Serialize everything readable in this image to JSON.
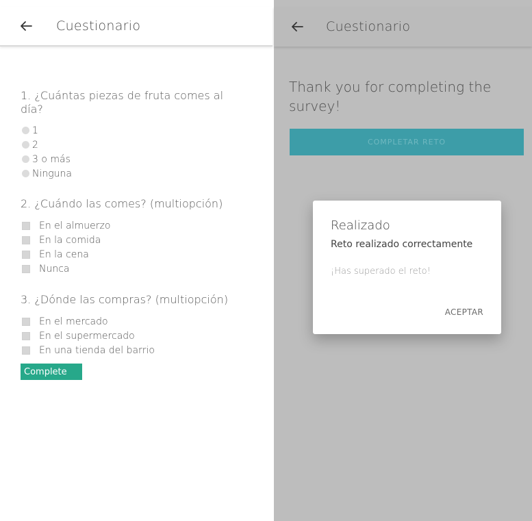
{
  "left_screen": {
    "appbar": {
      "title": "Cuestionario"
    },
    "questions": [
      {
        "text": "1. ¿Cuántas piezas de fruta comes al día?",
        "type": "radio",
        "options": [
          "1",
          "2",
          "3 o más",
          "Ninguna"
        ]
      },
      {
        "text": "2. ¿Cuándo las comes? (multiopción)",
        "type": "checkbox",
        "options": [
          "En el almuerzo",
          "En la comida",
          "En la cena",
          "Nunca"
        ]
      },
      {
        "text": "3. ¿Dónde las compras? (multiopción)",
        "type": "checkbox",
        "options": [
          "En el mercado",
          "En el supermercado",
          "En una tienda del barrio"
        ]
      }
    ],
    "complete_label": "Complete"
  },
  "right_screen": {
    "appbar": {
      "title": "Cuestionario"
    },
    "thanks_text": "Thank you for completing the survey!",
    "challenge_button_label": "COMPLETAR RETO",
    "dialog": {
      "title": "Realizado",
      "message": "Reto realizado correctamente",
      "sub_message": "¡Has superado el reto!",
      "accept_label": "ACEPTAR"
    }
  },
  "colors": {
    "complete_button": "#27a88a",
    "challenge_button": "#3d9da8",
    "overlay": "#bdbdbd"
  },
  "icons": {
    "back": "arrow-left-icon"
  }
}
